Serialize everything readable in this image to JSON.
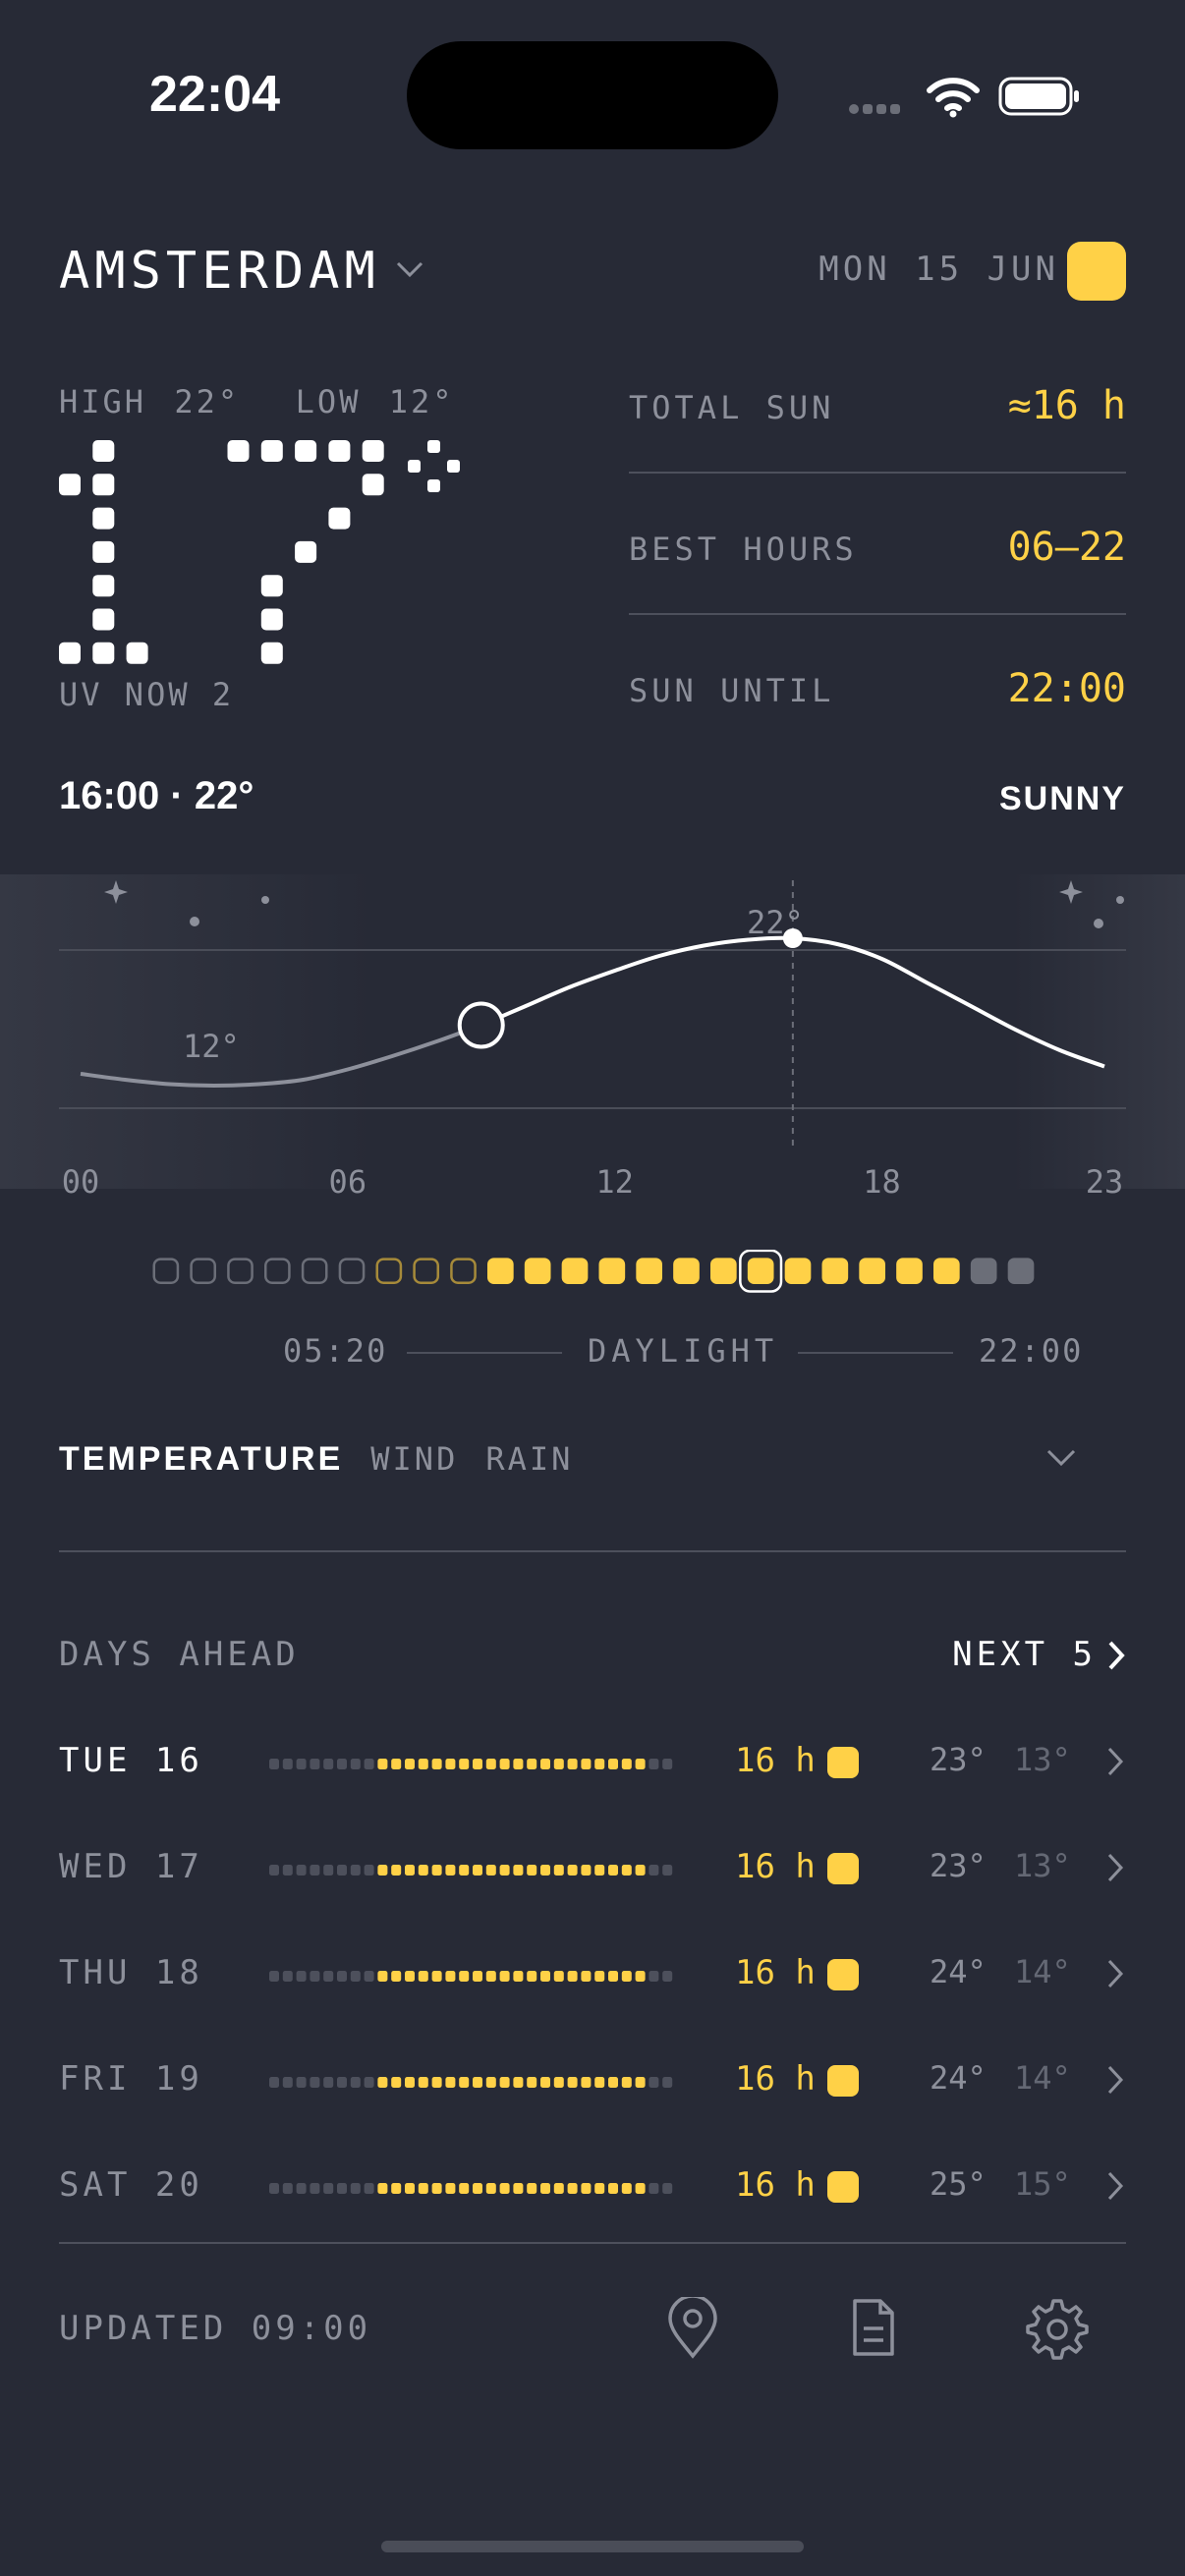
{
  "status": {
    "time": "22:04"
  },
  "header": {
    "city": "AMSTERDAM",
    "date": "MON 15 JUN"
  },
  "current": {
    "high_low": "HIGH 22°  LOW 12°",
    "temp": 17,
    "uv": "UV NOW 2"
  },
  "stats": [
    {
      "label": "TOTAL SUN",
      "value": "≈16 h"
    },
    {
      "label": "BEST HOURS",
      "value": "06–22"
    },
    {
      "label": "SUN UNTIL",
      "value": "22:00"
    }
  ],
  "now": {
    "time_temp": "16:00 · 22°",
    "condition": "SUNNY"
  },
  "chart_data": {
    "type": "line",
    "x": [
      0,
      1,
      2,
      3,
      4,
      5,
      6,
      7,
      8,
      9,
      10,
      11,
      12,
      13,
      14,
      15,
      16,
      17,
      18,
      19,
      20,
      21,
      22,
      23
    ],
    "values": [
      12.8,
      12.4,
      12.1,
      12.0,
      12.1,
      12.4,
      13.1,
      14.0,
      15.0,
      16.1,
      17.4,
      18.7,
      19.8,
      20.8,
      21.5,
      21.9,
      22.0,
      21.6,
      20.6,
      19.0,
      17.4,
      15.8,
      14.4,
      13.3
    ],
    "x_ticks": [
      "00",
      "06",
      "12",
      "18",
      "23"
    ],
    "annotations": [
      "22°",
      "12°"
    ],
    "current_hour": 9,
    "selected_hour": 16,
    "ylim": [
      11,
      23
    ]
  },
  "hours": {
    "states": [
      "night",
      "night",
      "night",
      "night",
      "night",
      "night",
      "dawn",
      "dawn",
      "dawn",
      "sun",
      "sun",
      "sun",
      "sun",
      "sun",
      "sun",
      "sun",
      "sun",
      "sun",
      "sun",
      "sun",
      "sun",
      "sun",
      "dusk",
      "dusk"
    ],
    "selected": 16
  },
  "daylight": {
    "start": "05:20",
    "label": "DAYLIGHT",
    "end": "22:00"
  },
  "tabs": [
    {
      "label": "TEMPERATURE",
      "active": true
    },
    {
      "label": "WIND",
      "active": false
    },
    {
      "label": "RAIN",
      "active": false
    }
  ],
  "days": {
    "title": "DAYS AHEAD",
    "next_label": "NEXT 5",
    "items": [
      {
        "name": "TUE 16",
        "sun": "16 h",
        "hi": "23°",
        "lo": "13°"
      },
      {
        "name": "WED 17",
        "sun": "16 h",
        "hi": "23°",
        "lo": "13°"
      },
      {
        "name": "THU 18",
        "sun": "16 h",
        "hi": "24°",
        "lo": "14°"
      },
      {
        "name": "FRI 19",
        "sun": "16 h",
        "hi": "24°",
        "lo": "14°"
      },
      {
        "name": "SAT 20",
        "sun": "16 h",
        "hi": "25°",
        "lo": "15°"
      }
    ]
  },
  "footer": {
    "updated": "UPDATED 09:00",
    "icons": [
      "location-pin-icon",
      "document-icon",
      "gear-icon"
    ]
  },
  "colors": {
    "accent": "#ffd147",
    "background": "#272a36"
  }
}
